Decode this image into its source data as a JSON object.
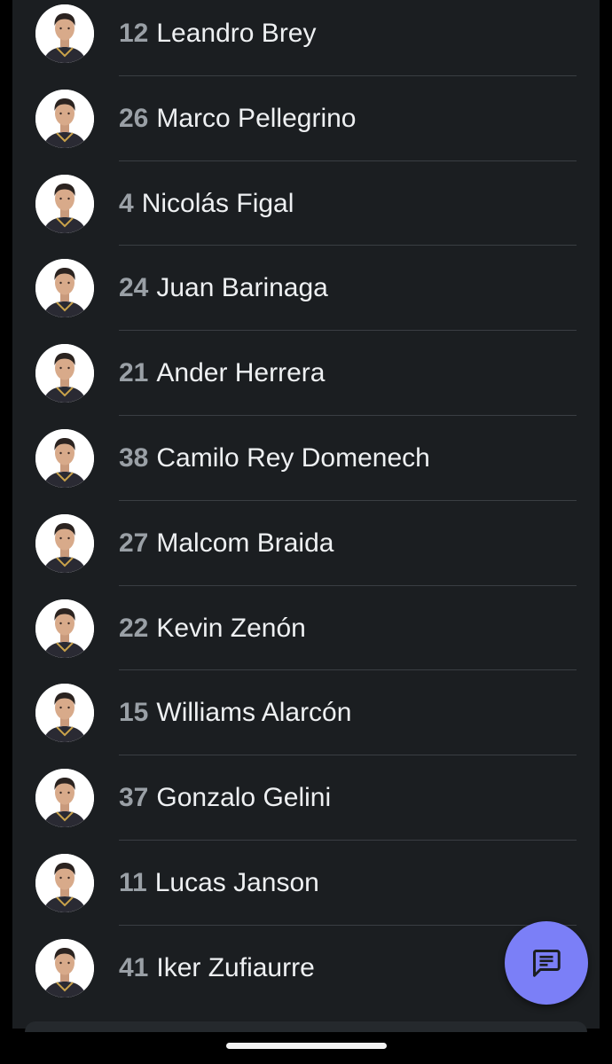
{
  "players": [
    {
      "number": "12",
      "name": "Leandro Brey",
      "avatar_icon": "player-photo"
    },
    {
      "number": "26",
      "name": "Marco Pellegrino",
      "avatar_icon": "player-photo"
    },
    {
      "number": "4",
      "name": "Nicolás Figal",
      "avatar_icon": "player-photo"
    },
    {
      "number": "24",
      "name": "Juan Barinaga",
      "avatar_icon": "player-photo"
    },
    {
      "number": "21",
      "name": "Ander Herrera",
      "avatar_icon": "player-photo"
    },
    {
      "number": "38",
      "name": "Camilo Rey Domenech",
      "avatar_icon": "player-photo"
    },
    {
      "number": "27",
      "name": "Malcom Braida",
      "avatar_icon": "player-photo"
    },
    {
      "number": "22",
      "name": "Kevin Zenón",
      "avatar_icon": "player-photo"
    },
    {
      "number": "15",
      "name": "Williams Alarcón",
      "avatar_icon": "player-photo"
    },
    {
      "number": "37",
      "name": "Gonzalo Gelini",
      "avatar_icon": "player-photo"
    },
    {
      "number": "11",
      "name": "Lucas Janson",
      "avatar_icon": "player-photo"
    },
    {
      "number": "41",
      "name": "Iker Zufiaurre",
      "avatar_icon": "player-photo"
    }
  ],
  "fab": {
    "icon": "chat-icon",
    "color": "#7b7ff7"
  },
  "colors": {
    "background": "#000000",
    "card": "#1b1e21",
    "number_text": "#9aa0a6",
    "name_text": "#eef0f2",
    "divider": "#3a3e43"
  }
}
